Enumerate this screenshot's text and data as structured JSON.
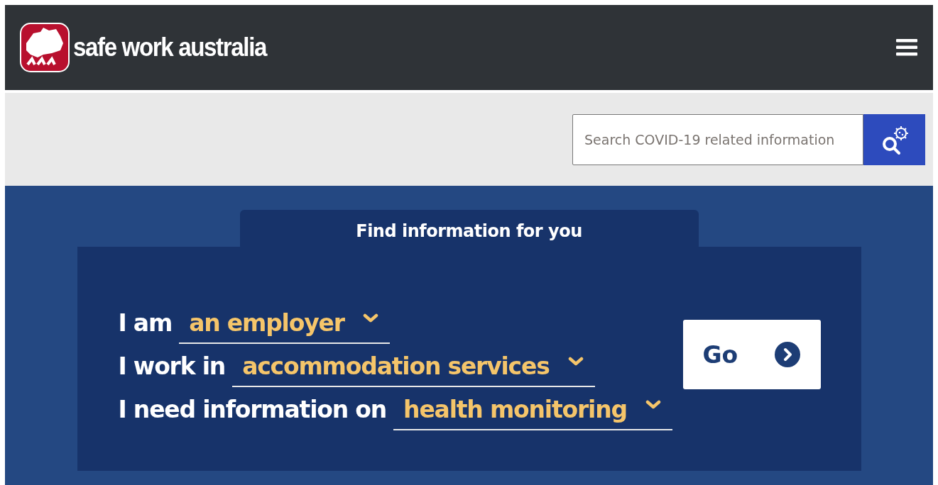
{
  "header": {
    "logo_text": "safe work australia"
  },
  "search": {
    "placeholder": "Search COVID-19 related information"
  },
  "finder": {
    "title": "Find information for you",
    "rows": [
      {
        "label": "I am",
        "value": "an employer"
      },
      {
        "label": "I work in",
        "value": "accommodation services"
      },
      {
        "label": "I need information on",
        "value": "health monitoring"
      }
    ],
    "button": "Go"
  }
}
